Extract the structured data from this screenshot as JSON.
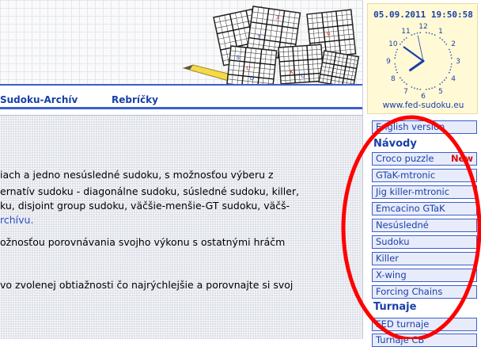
{
  "nav": {
    "archive": "Sudoku-Archív",
    "rankings": "Rebríčky"
  },
  "content": {
    "lines": [
      "iach a jedno nesúsledné sudoku, s možnosťou výberu z",
      "ernatív sudoku - diagonálne sudoku, súsledné sudoku, killer,",
      "ku, disjoint group sudoku, väčšie-menšie-GT sudoku, väčš-",
      "rchívu.",
      "ožnosťou porovnávania svojho výkonu s ostatnými hráčm",
      "vo zvolenej obtiažnosti čo najrýchlejšie a porovnajte si svoj"
    ]
  },
  "clock": {
    "datetime": "05.09.2011  19:50:58",
    "numbers": [
      "12",
      "1",
      "2",
      "3",
      "4",
      "5",
      "6",
      "7",
      "8",
      "9",
      "10",
      "11"
    ],
    "url": "www.fed-sudoku.eu",
    "time": {
      "hours": 19,
      "minutes": 50,
      "seconds": 58
    }
  },
  "sidebar": {
    "english": "English version",
    "guides_heading": "Návody",
    "guides": [
      {
        "label": "Croco puzzle",
        "badge": "New"
      },
      {
        "label": "GTaK-mtronic"
      },
      {
        "label": "Jig killer-mtronic"
      },
      {
        "label": "Emcacino GTaK"
      },
      {
        "label": "Nesúsledné"
      },
      {
        "label": "Sudoku"
      },
      {
        "label": "Killer"
      },
      {
        "label": "X-wing"
      },
      {
        "label": "Forcing Chains"
      }
    ],
    "tournaments_heading": "Turnaje",
    "tournaments": [
      {
        "label": "FED turnaje"
      },
      {
        "label": "Turnaje CB"
      }
    ]
  },
  "colors": {
    "accent": "#1a3fa8",
    "highlight": "#ff0000",
    "new_badge": "#d01010",
    "clock_bg": "#fff9d6"
  }
}
